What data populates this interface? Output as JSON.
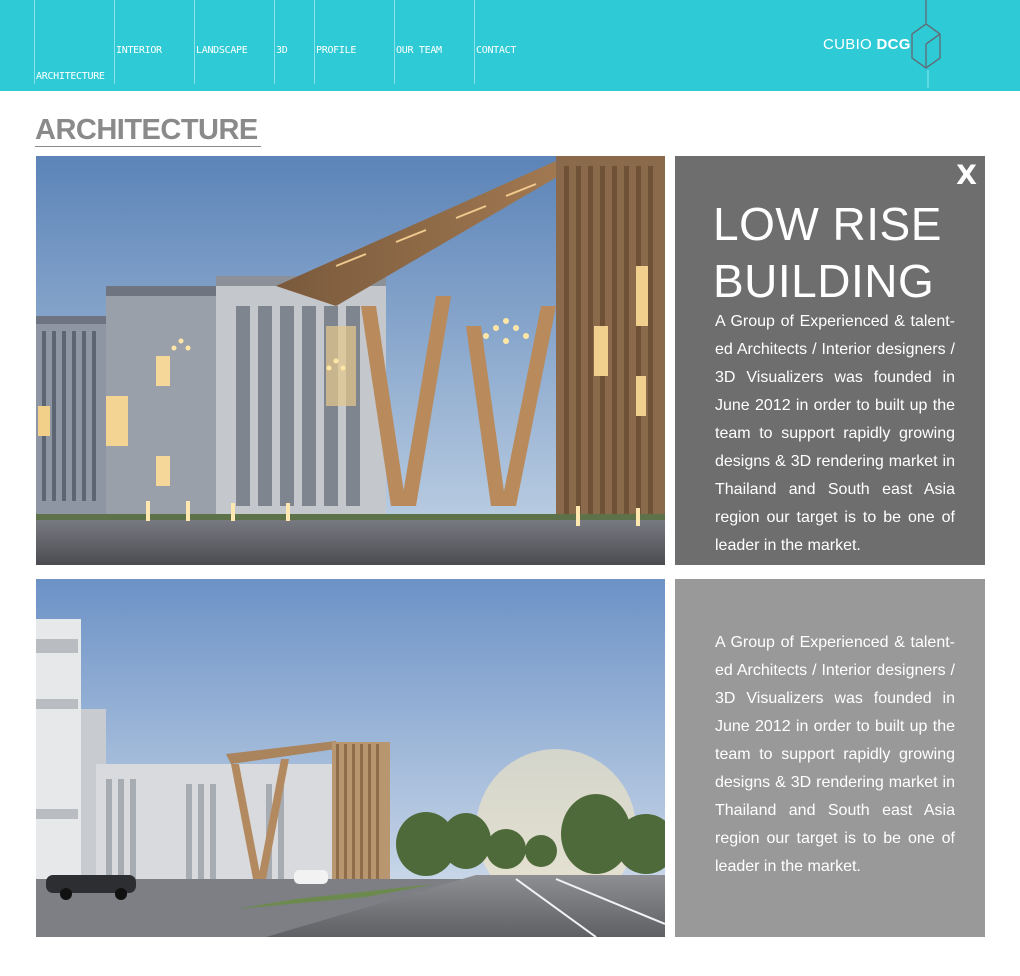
{
  "nav": {
    "items": [
      {
        "label": "ARCHITECTURE"
      },
      {
        "label": "INTERIOR"
      },
      {
        "label": "LANDSCAPE"
      },
      {
        "label": "3D"
      },
      {
        "label": "PROFILE"
      },
      {
        "label": "OUR TEAM"
      },
      {
        "label": "CONTACT"
      }
    ],
    "active": "ARCHITECTURE"
  },
  "brand": {
    "name": "CUBIO",
    "name_bold": "DCG"
  },
  "section": {
    "title": "ARCHITECTURE"
  },
  "projects": [
    {
      "title_line1": "LOW RISE",
      "title_line2": "BUILDING",
      "close_label": "X",
      "description": "A Group of Experienced & talent-ed Architects / Interior designers / 3D Visualizers was founded in June 2012 in order to built up the team to support rapidly growing designs & 3D rendering market in Thailand and South east Asia region our target is to be one of leader in the market."
    },
    {
      "description": "A Group of Experienced & talent-ed Architects / Interior designers / 3D Visualizers was founded in June 2012 in order to built up the team to support rapidly growing designs & 3D rendering market in Thailand and South east Asia region our target is to be one of leader in the market."
    }
  ],
  "colors": {
    "nav_bg": "#2ecbd6",
    "panel_dark": "#6e6e6e",
    "panel_light": "#999999",
    "heading": "#8a8a8a"
  }
}
